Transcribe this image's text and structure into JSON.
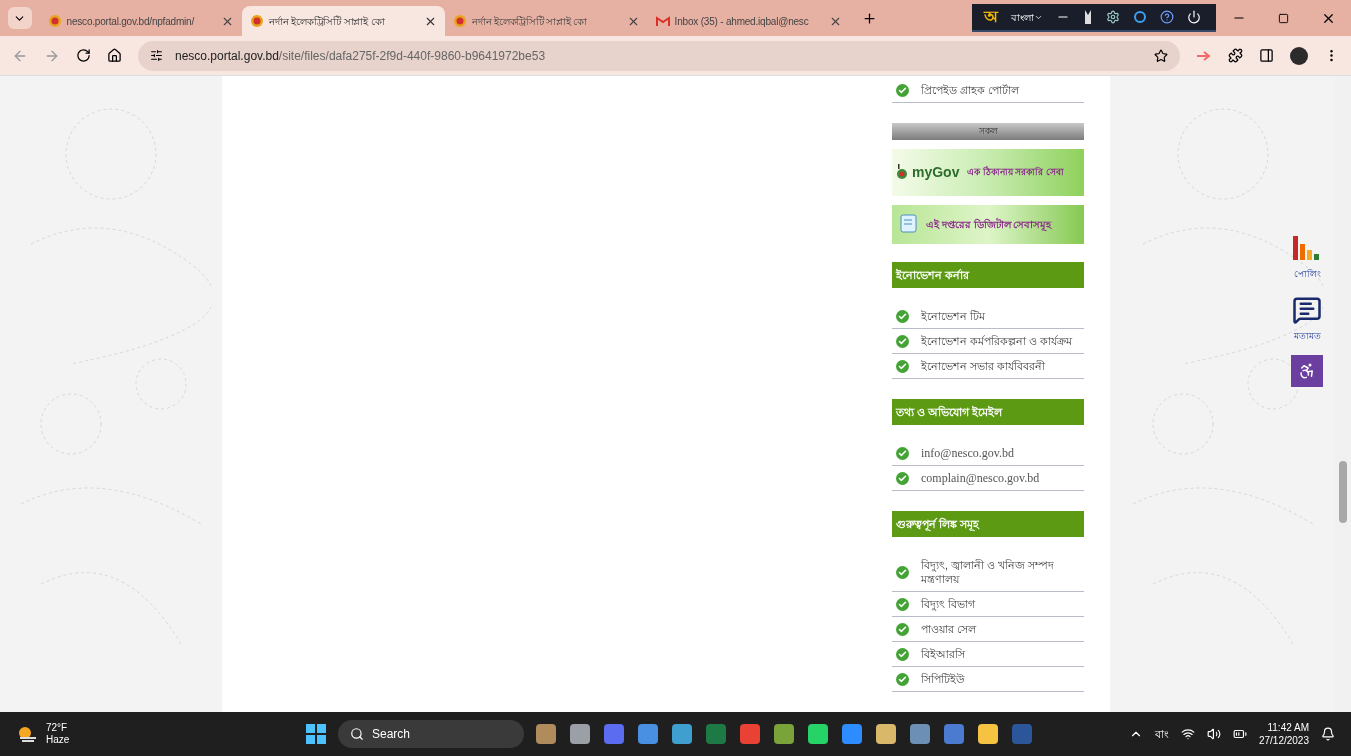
{
  "browser": {
    "tabs": [
      {
        "title": "nesco.portal.gov.bd/npfadmin/",
        "selected": false,
        "kind": "site"
      },
      {
        "title": "নর্দান ইলেকট্রিসিটি সাপ্লাই কো",
        "selected": true,
        "kind": "site"
      },
      {
        "title": "নর্দান ইলেকট্রিসিটি সাপ্লাই কো",
        "selected": false,
        "kind": "site"
      },
      {
        "title": "Inbox (35) - ahmed.iqbal@nesc",
        "selected": false,
        "kind": "mail"
      }
    ],
    "ime_toolbar": {
      "logo": "অ",
      "language": "বাংলা"
    },
    "address": {
      "host": "nesco.portal.gov.bd",
      "path": "/site/files/dafa275f-2f9d-440f-9860-b9641972be53"
    }
  },
  "sidebar": [
    {
      "kind": "list",
      "items": [
        "প্রিপেইড গ্রাহক পোর্টাল"
      ]
    },
    {
      "kind": "button",
      "label": "সকল"
    },
    {
      "kind": "mygov",
      "logo": "myGov",
      "label": "এক ঠিকানায় সরকারি সেবা"
    },
    {
      "kind": "digital",
      "label": "এই দপ্তরের ডিজিটাল সেবাসমূহ"
    },
    {
      "kind": "header",
      "label": "ইনোভেশন কর্নার"
    },
    {
      "kind": "list",
      "items": [
        "ইনোভেশন টিম",
        "ইনোভেশন কর্মপরিকল্পনা ও কার্যক্রম",
        "ইনোভেশন সভার কার্যবিবরনী"
      ]
    },
    {
      "kind": "header",
      "label": "তথ্য ও অভিযোগ ইমেইল"
    },
    {
      "kind": "email",
      "items": [
        "info@nesco.gov.bd",
        "complain@nesco.gov.bd"
      ]
    },
    {
      "kind": "header",
      "label": "গুরুত্বপূর্ন লিঙ্ক সমূহ"
    },
    {
      "kind": "list",
      "items": [
        "বিদ্যুৎ, জ্বালানী ও খনিজ সম্পদ মন্ত্রণালয়",
        "বিদ্যুৎ বিভাগ",
        "পাওয়ার সেল",
        "বিইআরসি",
        "সিপিটিইউ"
      ]
    }
  ],
  "floating": {
    "poll_label": "পোলিং",
    "feedback_label": "মতামত"
  },
  "taskbar": {
    "temperature": "72°F",
    "weather": "Haze",
    "search": "Search",
    "ime": "বাং",
    "time": "11:42 AM",
    "date": "27/12/2023"
  }
}
